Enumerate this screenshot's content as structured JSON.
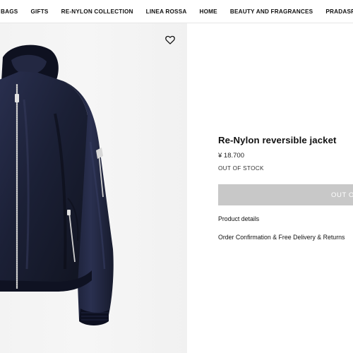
{
  "nav": {
    "items": [
      {
        "label": "BAGS"
      },
      {
        "label": "GIFTS"
      },
      {
        "label": "RE-NYLON COLLECTION"
      },
      {
        "label": "LINEA ROSSA"
      },
      {
        "label": "HOME"
      },
      {
        "label": "BEAUTY AND FRAGRANCES"
      },
      {
        "label": "PRADASPHERE"
      }
    ]
  },
  "product": {
    "title": "Re-Nylon reversible jacket",
    "price": "¥ 18.700",
    "stock_status": "OUT OF STOCK",
    "cta_label": "OUT OF STOCK",
    "links": {
      "details": "Product details",
      "delivery": "Order Confirmation & Free Delivery & Returns"
    },
    "image": {
      "icon": "heart-icon",
      "jacket_color": "#1d2236"
    }
  },
  "colors": {
    "cta_bg": "#c8c8c8",
    "image_bg": "#f3f3f3"
  }
}
